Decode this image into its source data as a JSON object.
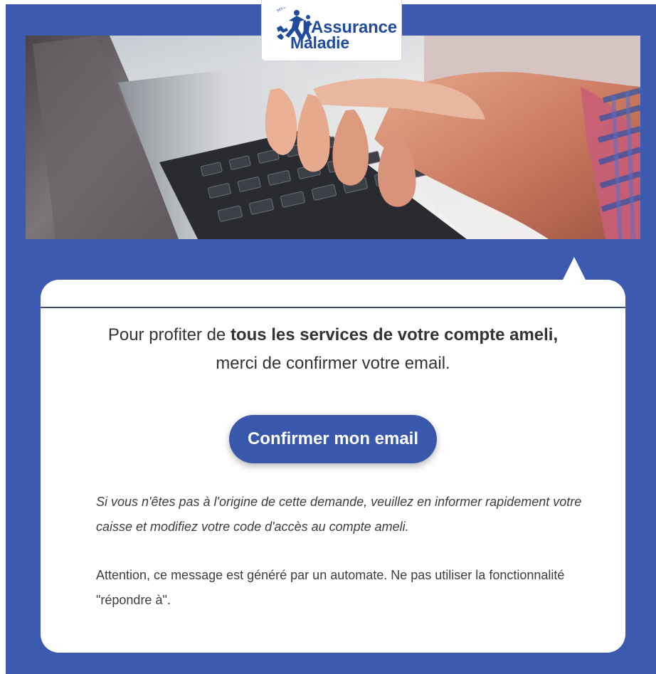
{
  "brand": {
    "logo_line1": "l'Assurance",
    "logo_line2": "Maladie",
    "primary_color": "#3c5bb0",
    "logo_color": "#214b9b"
  },
  "hero": {
    "image_description": "laptop-keyboard-typing-hands"
  },
  "message": {
    "intro_prefix": "Pour profiter de ",
    "intro_strong": "tous les services de votre compte ameli,",
    "intro_line2": "merci de confirmer votre email.",
    "button_label": "Confirmer mon email",
    "warning_text": "Si vous n'êtes pas à l'origine de cette demande, veuillez en informer rapidement votre caisse et modifiez votre code d'accès au compte ameli.",
    "automate_text": "Attention, ce message est généré par un automate. Ne pas utiliser la fonctionnalité \"répondre à\"."
  }
}
